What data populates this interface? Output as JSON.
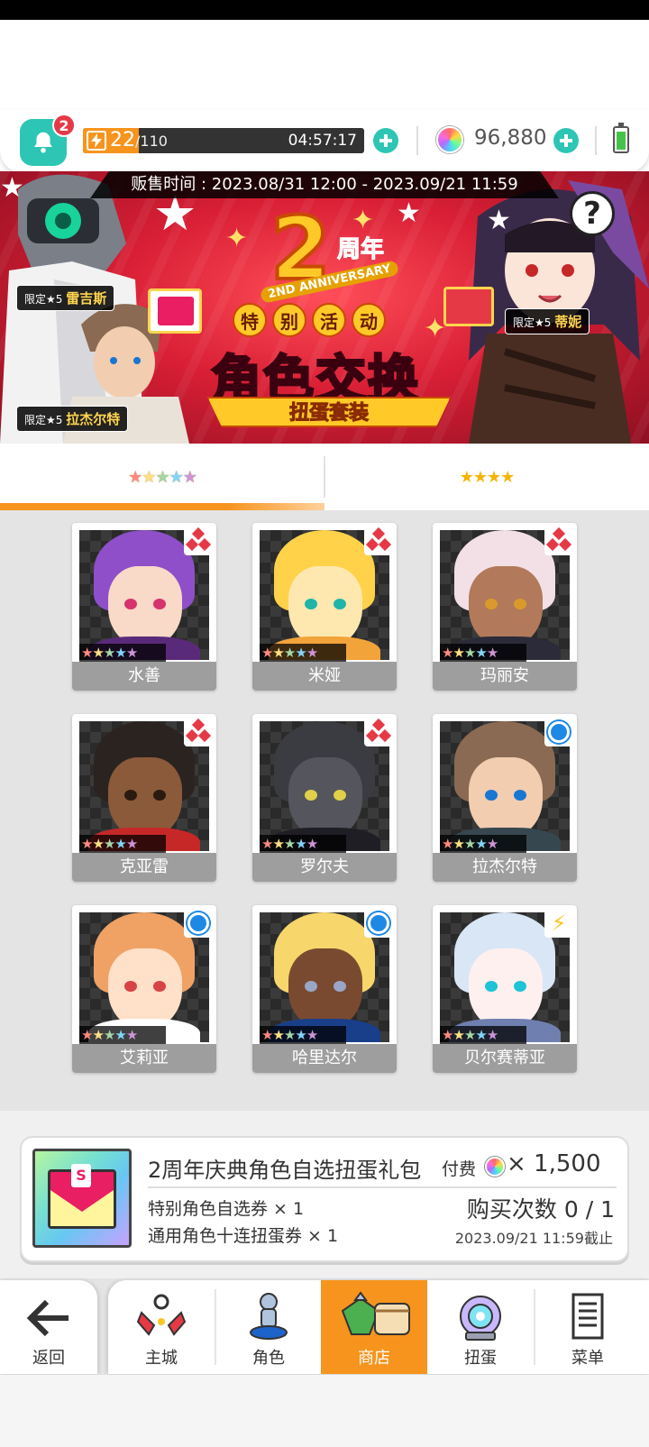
{
  "hud": {
    "notification_count": "2",
    "stamina_current": "22",
    "stamina_max": "/110",
    "stamina_fraction": 0.2,
    "stamina_timer": "04:57:17",
    "gems": "96,880"
  },
  "banner": {
    "sale_period": "贩售时间 : 2023.08/31 12:00 - 2023.09/21 11:59",
    "anniversary_number": "2",
    "anniversary_cn": "周年",
    "anniversary_en": "2ND ANNIVERSARY",
    "event_chars": [
      "特",
      "别",
      "活",
      "动"
    ],
    "title": "角色交换",
    "subtitle": "扭蛋套装",
    "tags": [
      {
        "prefix": "限定★5",
        "name": "雷吉斯"
      },
      {
        "prefix": "限定★5",
        "name": "拉杰尔特"
      },
      {
        "prefix": "限定★5",
        "name": "蒂妮"
      }
    ],
    "help": "?"
  },
  "tabs": [
    {
      "stars": "★★★★★",
      "active": true
    },
    {
      "stars": "★★★★",
      "active": false
    }
  ],
  "characters": [
    {
      "name": "水善",
      "element": "diamonds",
      "hair": "#8e4fc9",
      "skin": "#f9d9c8",
      "body": "#5a2a7a",
      "eye": "#d6336c"
    },
    {
      "name": "米娅",
      "element": "diamonds",
      "hair": "#ffd24a",
      "skin": "#ffe8b0",
      "body": "#f2a33a",
      "eye": "#1fb5a8"
    },
    {
      "name": "玛丽安",
      "element": "diamonds",
      "hair": "#f2e0e6",
      "skin": "#b27a5a",
      "body": "#2b2b3a",
      "eye": "#d99a2b"
    },
    {
      "name": "克亚雷",
      "element": "diamonds",
      "hair": "#2b2320",
      "skin": "#8a5a3a",
      "body": "#c62828",
      "eye": "#2b1a10"
    },
    {
      "name": "罗尔夫",
      "element": "diamonds",
      "hair": "#3b3b42",
      "skin": "#55555e",
      "body": "#1e1e24",
      "eye": "#e0d04a"
    },
    {
      "name": "拉杰尔特",
      "element": "ring",
      "hair": "#8a6a52",
      "skin": "#f2cdb0",
      "body": "#37474f",
      "eye": "#1976d2"
    },
    {
      "name": "艾莉亚",
      "element": "ring",
      "hair": "#f0a264",
      "skin": "#ffe0c8",
      "body": "#ffffff",
      "eye": "#d84343"
    },
    {
      "name": "哈里达尔",
      "element": "ring",
      "hair": "#f7d66b",
      "skin": "#7a4a30",
      "body": "#1a3f8a",
      "eye": "#9aa6c8"
    },
    {
      "name": "贝尔赛蒂亚",
      "element": "bolt",
      "hair": "#d9e6f5",
      "skin": "#fff0f0",
      "body": "#6f7fb0",
      "eye": "#1ec3d6"
    }
  ],
  "card_stars": "★★★★★",
  "pack": {
    "name": "2周年庆典角色自选扭蛋礼包",
    "price_label": "付费",
    "price": "× 1,500",
    "items": [
      "特别角色自选券 × 1",
      "通用角色十连扭蛋券 × 1"
    ],
    "purchase_count": "购买次数 0 / 1",
    "deadline": "2023.09/21 11:59截止",
    "thumb_letter": "S"
  },
  "nav": {
    "back": "返回",
    "items": [
      {
        "label": "主城",
        "active": false
      },
      {
        "label": "角色",
        "active": false
      },
      {
        "label": "商店",
        "active": true
      },
      {
        "label": "扭蛋",
        "active": false
      },
      {
        "label": "菜单",
        "active": false
      }
    ]
  },
  "colors": {
    "accent_orange": "#f7941d",
    "teal": "#2dc6b4",
    "banner_red": "#d91f35",
    "badge_red": "#e53946"
  },
  "icons": [
    "bell-icon",
    "lightning-icon",
    "plus-icon",
    "gem-icon",
    "battery-icon",
    "help-icon",
    "back-arrow-icon",
    "town-icon",
    "character-icon",
    "shop-icon",
    "gacha-icon",
    "menu-icon"
  ]
}
